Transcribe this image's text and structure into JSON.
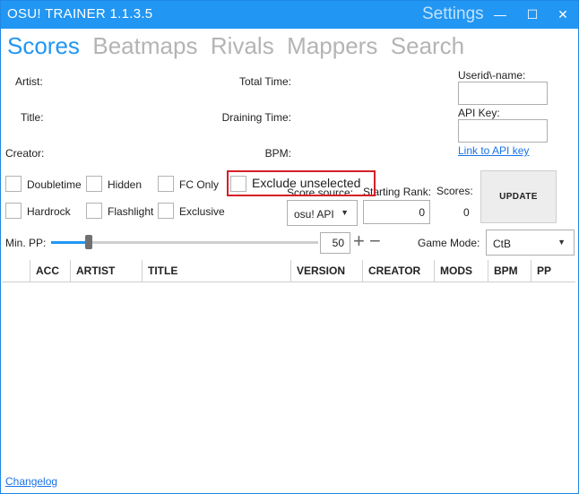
{
  "app_title": "OSU! TRAINER 1.1.3.5",
  "settings_label": "Settings",
  "window_controls": {
    "minimize": "—",
    "maximize": "☐",
    "close": "✕"
  },
  "tabs": [
    "Scores",
    "Beatmaps",
    "Rivals",
    "Mappers",
    "Search"
  ],
  "info": {
    "artist": "Artist:",
    "title": "Title:",
    "creator": "Creator:",
    "total_time": "Total Time:",
    "draining_time": "Draining Time:",
    "bpm": "BPM:"
  },
  "user": {
    "userid_label": "Userid\\-name:",
    "userid_value": "",
    "apikey_label": "API Key:",
    "apikey_value": "",
    "apikey_link": "Link to API key"
  },
  "mods": {
    "doubletime": "Doubletime",
    "hidden": "Hidden",
    "fc_only": "FC Only",
    "hardrock": "Hardrock",
    "flashlight": "Flashlight",
    "exclusive": "Exclusive",
    "exclude_unselected": "Exclude unselected"
  },
  "score_source": {
    "label": "Score source:",
    "value": "osu! API"
  },
  "starting_rank": {
    "label": "Starting Rank:",
    "value": "0"
  },
  "scores": {
    "label": "Scores:",
    "value": "0"
  },
  "update_button": "UPDATE",
  "min_pp": {
    "label": "Min. PP:",
    "value": "50",
    "fraction": 0.14,
    "plus": "+",
    "minus": "−"
  },
  "game_mode": {
    "label": "Game Mode:",
    "value": "CtB"
  },
  "columns": [
    "ACC",
    "ARTIST",
    "TITLE",
    "VERSION",
    "CREATOR",
    "MODS",
    "BPM",
    "PP"
  ],
  "changelog": "Changelog",
  "colors": {
    "accent": "#2196f3",
    "highlight": "#d61f26"
  }
}
